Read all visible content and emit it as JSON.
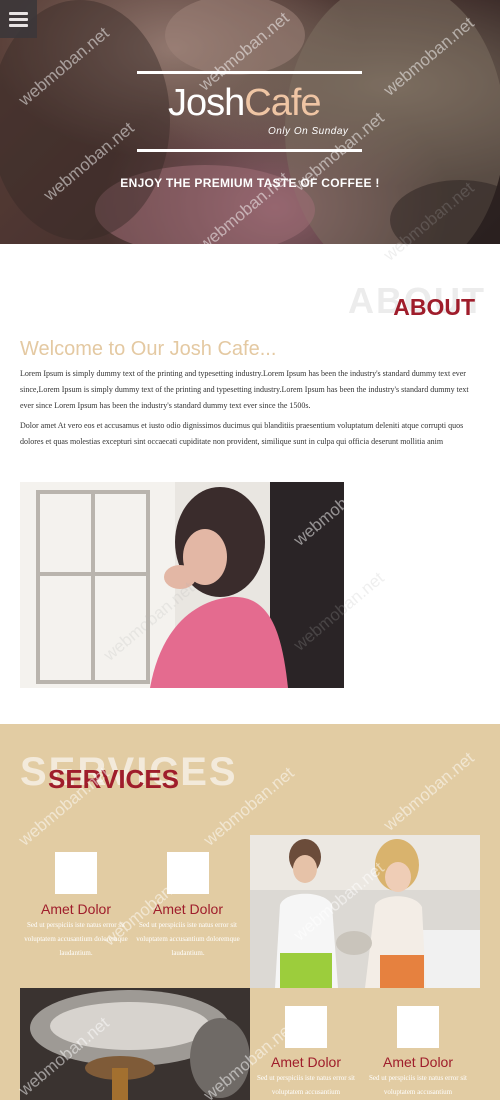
{
  "nav": {
    "menu_icon": "hamburger-icon"
  },
  "hero": {
    "logo_part1": "Josh",
    "logo_part2": "Cafe",
    "tagline": "Only On Sunday",
    "subtitle": "ENJOY THE PREMIUM TASTE OF COFFEE !"
  },
  "about": {
    "ghost_title": "ABOUT",
    "title": "ABOUT",
    "welcome": "Welcome to Our Josh Cafe...",
    "paragraph1": "Lorem Ipsum is simply dummy text of the printing and typesetting industry.Lorem Ipsum has been the industry's standard dummy text ever since,Lorem Ipsum is simply dummy text of the printing and typesetting industry.Lorem Ipsum has been the industry's standard dummy text ever since Lorem Ipsum has been the industry's standard dummy text ever since the 1500s.",
    "paragraph2": "Dolor amet At vero eos et accusamus et iusto odio dignissimos ducimus qui blanditiis praesentium voluptatum deleniti atque corrupti quos dolores et quas molestias excepturi sint occaecati cupiditate non provident, similique sunt in culpa qui officia deserunt mollitia anim"
  },
  "services": {
    "ghost_title": "SERVICES",
    "title": "SERVICES",
    "items": [
      {
        "name": "Amet Dolor",
        "desc": "Sed ut perspiciis iste natus error sit voluptatem accusantium doloremque laudantium."
      },
      {
        "name": "Amet Dolor",
        "desc": "Sed ut perspiciis iste natus error sit voluptatem accusantium doloremque laudantium."
      },
      {
        "name": "Amet Dolor",
        "desc": "Sed ut perspiciis iste natus error sit voluptatem accusantium"
      },
      {
        "name": "Amet Dolor",
        "desc": "Sed ut perspiciis iste natus error sit voluptatem accusantium"
      }
    ]
  },
  "watermark": "webmoban.net",
  "colors": {
    "accent": "#9f1d2b",
    "sand": "#e2cca3",
    "peach": "#efc5a4"
  }
}
